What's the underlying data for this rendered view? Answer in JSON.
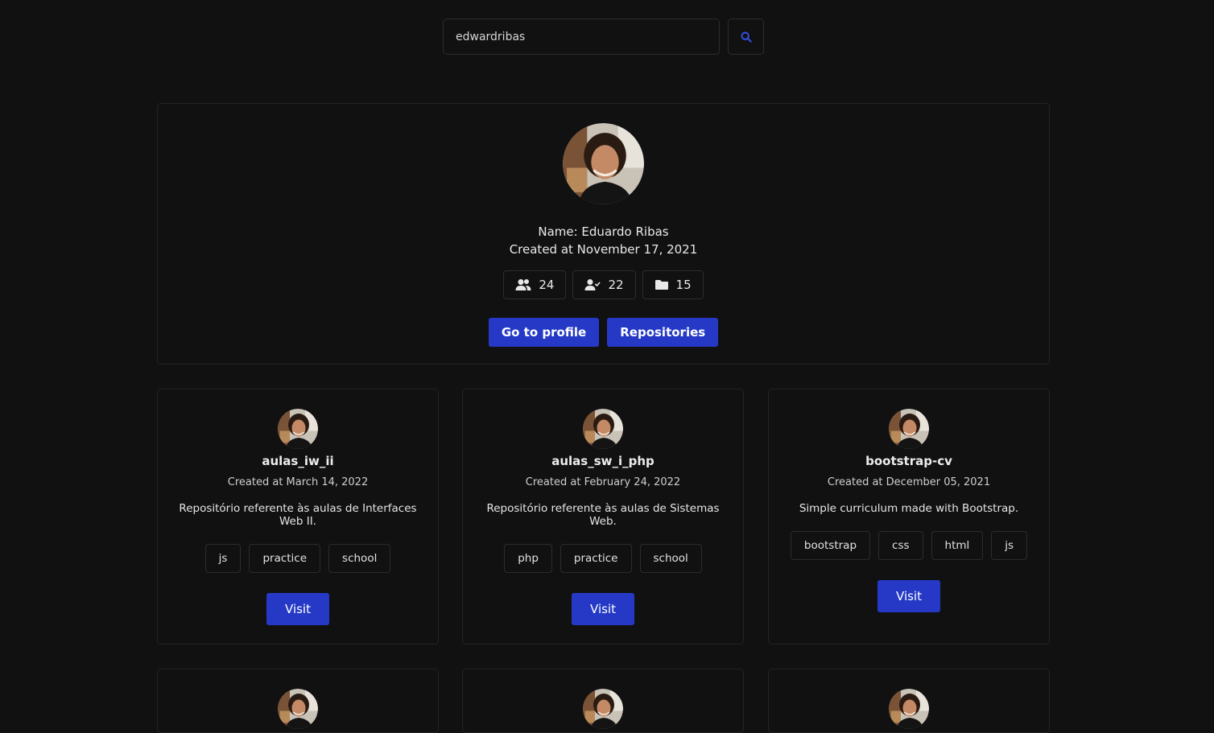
{
  "search": {
    "value": "edwardribas",
    "button_icon": "search-icon"
  },
  "profile": {
    "name_line": "Name: Eduardo Ribas",
    "created_line": "Created at November 17, 2021",
    "stats": {
      "followers": "24",
      "following": "22",
      "repos": "15"
    },
    "buttons": {
      "profile": "Go to profile",
      "repositories": "Repositories"
    }
  },
  "repos": [
    {
      "name": "aulas_iw_ii",
      "created": "Created at March 14, 2022",
      "description": "Repositório referente às aulas de Interfaces Web II.",
      "tags": [
        "js",
        "practice",
        "school"
      ],
      "visit": "Visit"
    },
    {
      "name": "aulas_sw_i_php",
      "created": "Created at February 24, 2022",
      "description": "Repositório referente às aulas de Sistemas Web.",
      "tags": [
        "php",
        "practice",
        "school"
      ],
      "visit": "Visit"
    },
    {
      "name": "bootstrap-cv",
      "created": "Created at December 05, 2021",
      "description": "Simple curriculum made with Bootstrap.",
      "tags": [
        "bootstrap",
        "css",
        "html",
        "js"
      ],
      "visit": "Visit"
    }
  ],
  "colors": {
    "background": "#111112",
    "accent": "#2539c6",
    "border": "#2c2c2e"
  }
}
